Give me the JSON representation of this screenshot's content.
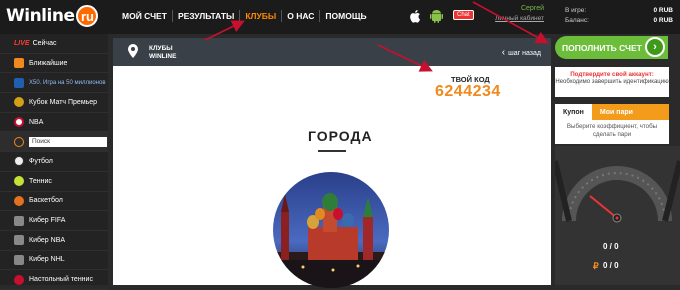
{
  "header": {
    "logo": "Winline",
    "logo_suffix": "ru",
    "nav": [
      "МОЙ СЧЕТ",
      "РЕЗУЛЬТАТЫ",
      "КЛУБЫ",
      "О НАС",
      "ПОМОЩЬ"
    ],
    "active_nav": "КЛУБЫ",
    "chat": "Chat",
    "user_name": "Сергей",
    "cabinet_link": "Личный кабинет",
    "balance": [
      {
        "label": "В игре:",
        "value": "0 RUB"
      },
      {
        "label": "Баланс:",
        "value": "0 RUB"
      }
    ]
  },
  "sidebar": {
    "items": [
      {
        "label": "Сейчас",
        "live": "LIVE"
      },
      {
        "label": "Ближайшие"
      },
      {
        "label": "X50. Игра на 50 миллионов"
      },
      {
        "label": "Кубок Матч Премьер"
      },
      {
        "label": "NBA"
      },
      {
        "label": "Поиск"
      },
      {
        "label": "Футбол"
      },
      {
        "label": "Теннис"
      },
      {
        "label": "Баскетбол"
      },
      {
        "label": "Кибер FIFA"
      },
      {
        "label": "Кибер NBA"
      },
      {
        "label": "Кибер NHL"
      },
      {
        "label": "Настольный теннис"
      }
    ]
  },
  "main": {
    "club_line1": "КЛУБЫ",
    "club_line2": "WINLINE",
    "back": "шаг назад",
    "code_label": "ТВОЙ КОД",
    "code_value": "6244234",
    "section_title": "ГОРОДА"
  },
  "right": {
    "topup": "ПОПОЛНИТЬ СЧЕТ",
    "confirm_title": "Подтвердите свой аккаунт:",
    "confirm_text": "Необходимо завершить идентификацию",
    "tab_coupon": "Купон",
    "tab_mine": "Мои пари",
    "coupon_hint": "Выберите коэффициент, чтобы сделать пари",
    "counter1": "0 / 0",
    "counter2": "0 / 0"
  },
  "colors": {
    "accent": "#f08a1e",
    "green": "#6cbd3a",
    "annotation": "#c8102e"
  }
}
